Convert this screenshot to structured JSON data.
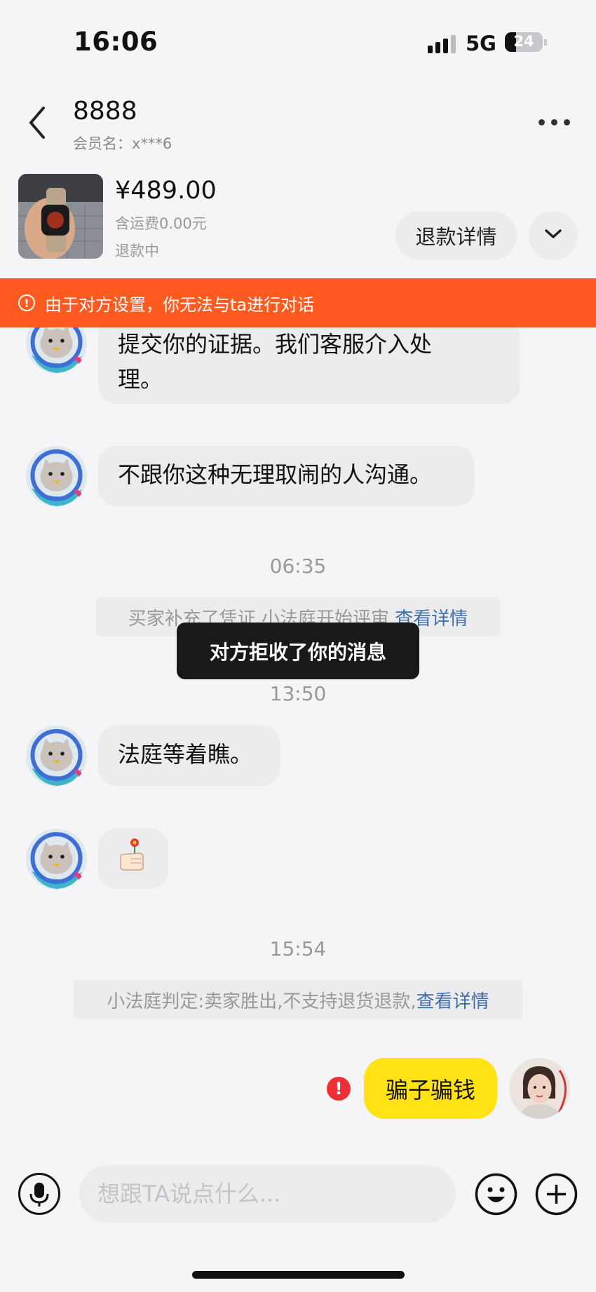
{
  "status_bar": {
    "time": "16:06",
    "network": "5G",
    "battery": "24"
  },
  "header": {
    "title": "8888",
    "member_label": "会员名：x***6"
  },
  "product": {
    "price": "¥489.00",
    "shipping": "含运费0.00元",
    "status": "退款中",
    "refund_button": "退款详情"
  },
  "banner": {
    "text": "由于对方设置，你无法与ta进行对话"
  },
  "messages": {
    "m1_line1": "提交你的证据。我们客服介入处",
    "m1_line2": "理。",
    "m2": "不跟你这种无理取闹的人沟通。",
    "time1": "06:35",
    "note1_text": "买家补充了凭证,小法庭开始评审,",
    "note1_link": "查看详情",
    "toast": "对方拒收了你的消息",
    "time2": "13:50",
    "m3": "法庭等着瞧。",
    "time3": "15:54",
    "note2_text": "小法庭判定:卖家胜出,不支持退货退款,",
    "note2_link": "查看详情",
    "own": "骗子骗钱"
  },
  "input": {
    "placeholder": "想跟TA说点什么..."
  },
  "colors": {
    "banner": "#ff5a1f",
    "own_bubble": "#ffe314",
    "link": "#3f6fa8",
    "error": "#ee2f35"
  },
  "icons": [
    "back-icon",
    "more-icon",
    "chevron-down-icon",
    "warning-icon",
    "error-icon",
    "microphone-icon",
    "emoji-icon",
    "plus-icon",
    "flower-hand-sticker"
  ]
}
